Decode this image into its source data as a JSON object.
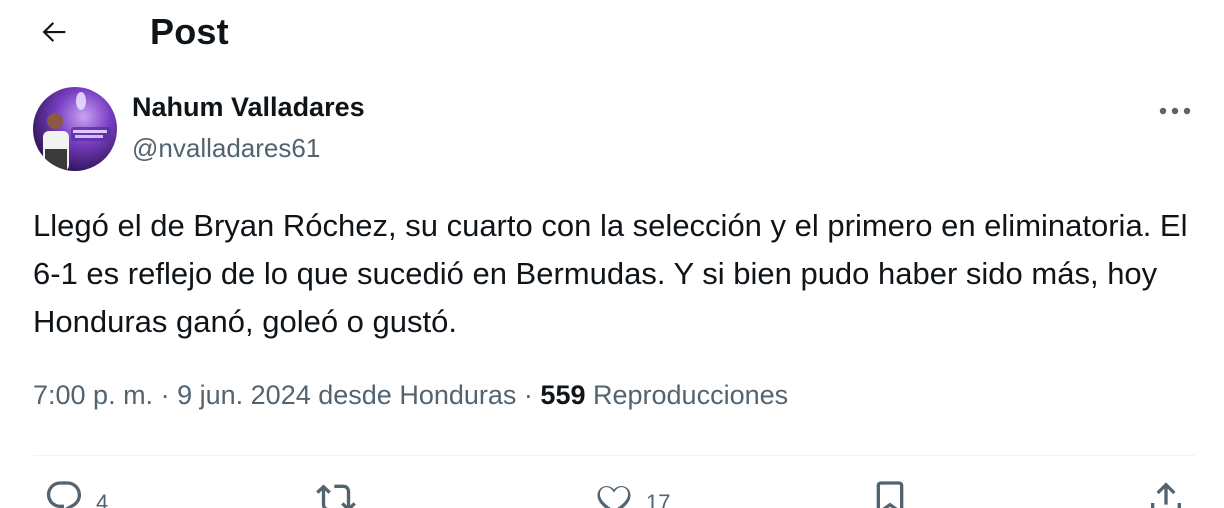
{
  "header": {
    "back_icon": "arrow-left-icon",
    "title": "Post"
  },
  "author": {
    "name": "Nahum Valladares",
    "handle": "@nvalladares61",
    "avatar_icon": "profile-photo"
  },
  "post": {
    "text": "Llegó el de Bryan Róchez, su cuarto con la selección y el primero en eliminatoria. El 6-1 es reflejo de lo que sucedió en Bermudas. Y si bien pudo haber sido más, hoy Honduras ganó, goleó o gustó.",
    "time": "7:00 p. m.",
    "separator": "·",
    "date": "9 jun. 2024",
    "location": "desde Honduras",
    "views_count": "559",
    "views_label": "Reproducciones"
  },
  "actions": {
    "reply_count": "4",
    "repost_count": "",
    "like_count": "17",
    "icons": [
      "reply-icon",
      "repost-icon",
      "like-icon",
      "bookmark-icon",
      "share-icon"
    ]
  },
  "colors": {
    "text_primary": "#0f1419",
    "text_secondary": "#536471",
    "divider": "#eff3f4"
  }
}
